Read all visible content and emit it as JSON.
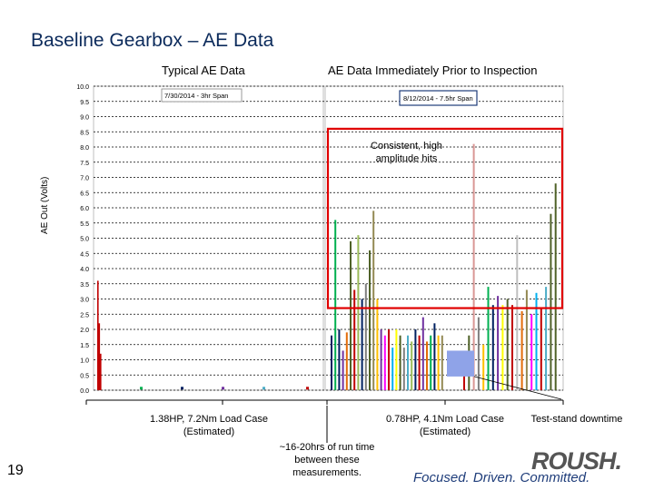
{
  "slide": {
    "title": "Baseline Gearbox – AE Data",
    "number": "19"
  },
  "chart_data": {
    "type": "bar",
    "ylabel": "AE Out (Volts)",
    "ylim": [
      0,
      10
    ],
    "yticks": [
      "0.0",
      "0.5",
      "1.0",
      "1.5",
      "2.0",
      "2.5",
      "3.0",
      "3.5",
      "4.0",
      "4.5",
      "5.0",
      "5.5",
      "6.0",
      "6.5",
      "7.0",
      "7.5",
      "8.0",
      "8.5",
      "9.0",
      "9.5",
      "10.0"
    ],
    "grid": true,
    "panels": [
      {
        "title": "Typical AE Data",
        "legend_text": "7/30/2014 - 3hr Span",
        "series": [
          {
            "color": "#c00000",
            "values": [
              3.6,
              2.2,
              1.2
            ]
          },
          {
            "color": "#00b050",
            "values": [
              0.1
            ]
          },
          {
            "color": "#002060",
            "values": [
              0.1
            ]
          },
          {
            "color": "#7030a0",
            "values": [
              0.1
            ]
          },
          {
            "color": "#4bacc6",
            "values": [
              0.1
            ]
          },
          {
            "color": "#c00000",
            "values": [
              0.1
            ]
          }
        ]
      },
      {
        "title": "AE Data Immediately Prior to Inspection",
        "legend_text": "8/12/2014 - 7.5hr Span",
        "bars": [
          {
            "v": 1.8,
            "c": "#002060"
          },
          {
            "v": 5.6,
            "c": "#00b050"
          },
          {
            "v": 2.0,
            "c": "#002060"
          },
          {
            "v": 1.3,
            "c": "#7030a0"
          },
          {
            "v": 1.9,
            "c": "#e36c09"
          },
          {
            "v": 4.9,
            "c": "#4f6228"
          },
          {
            "v": 3.3,
            "c": "#c00000"
          },
          {
            "v": 5.1,
            "c": "#9bbb59"
          },
          {
            "v": 3.0,
            "c": "#002060"
          },
          {
            "v": 3.5,
            "c": "#7f7f7f"
          },
          {
            "v": 4.6,
            "c": "#4f6228"
          },
          {
            "v": 5.9,
            "c": "#938953"
          },
          {
            "v": 3.0,
            "c": "#ffc000"
          },
          {
            "v": 2.0,
            "c": "#7030a0"
          },
          {
            "v": 1.8,
            "c": "#ff00ff"
          },
          {
            "v": 2.0,
            "c": "#c00000"
          },
          {
            "v": 1.4,
            "c": "#00b0f0"
          },
          {
            "v": 2.0,
            "c": "#ffff00"
          },
          {
            "v": 1.8,
            "c": "#4f6228"
          },
          {
            "v": 1.4,
            "c": "#7f7f7f"
          },
          {
            "v": 1.8,
            "c": "#4bacc6"
          },
          {
            "v": 1.6,
            "c": "#9bbb59"
          },
          {
            "v": 2.0,
            "c": "#002060"
          },
          {
            "v": 1.8,
            "c": "#c00000"
          },
          {
            "v": 2.4,
            "c": "#7030a0"
          },
          {
            "v": 1.6,
            "c": "#e36c09"
          },
          {
            "v": 1.8,
            "c": "#00b050"
          },
          {
            "v": 2.2,
            "c": "#002060"
          },
          {
            "v": 1.8,
            "c": "#ffc000"
          },
          {
            "v": 1.8,
            "c": "#938953"
          },
          {
            "v": 1.2,
            "c": "#c00000"
          },
          {
            "v": 1.8,
            "c": "#4f6228"
          },
          {
            "v": 8.1,
            "c": "#d99694"
          },
          {
            "v": 2.4,
            "c": "#7f7f7f"
          },
          {
            "v": 1.5,
            "c": "#ffc000"
          },
          {
            "v": 3.4,
            "c": "#00b050"
          },
          {
            "v": 2.8,
            "c": "#002060"
          },
          {
            "v": 3.1,
            "c": "#7030a0"
          },
          {
            "v": 2.8,
            "c": "#ffff00"
          },
          {
            "v": 3.0,
            "c": "#4f6228"
          },
          {
            "v": 2.8,
            "c": "#c00000"
          },
          {
            "v": 5.1,
            "c": "#bfbfbf"
          },
          {
            "v": 2.6,
            "c": "#e36c09"
          },
          {
            "v": 3.3,
            "c": "#938953"
          },
          {
            "v": 2.5,
            "c": "#ff00ff"
          },
          {
            "v": 3.2,
            "c": "#00b0f0"
          },
          {
            "v": 2.7,
            "c": "#c00000"
          },
          {
            "v": 3.4,
            "c": "#4bacc6"
          },
          {
            "v": 5.8,
            "c": "#4f6228"
          },
          {
            "v": 6.8,
            "c": "#4f6228"
          }
        ],
        "highlight_box": {
          "ymin": 2.7,
          "ymax": 8.6
        }
      }
    ],
    "annotations": [
      "Consistent, high amplitude hits",
      "1.38HP, 7.2Nm Load Case (Estimated)",
      "0.78HP, 4.1Nm Load Case (Estimated)",
      "Test-stand downtime",
      "~16-20hrs of run time between these measurements."
    ]
  },
  "logo": {
    "mark": "ROUSH.",
    "tagline": "Focused. Driven. Committed."
  }
}
